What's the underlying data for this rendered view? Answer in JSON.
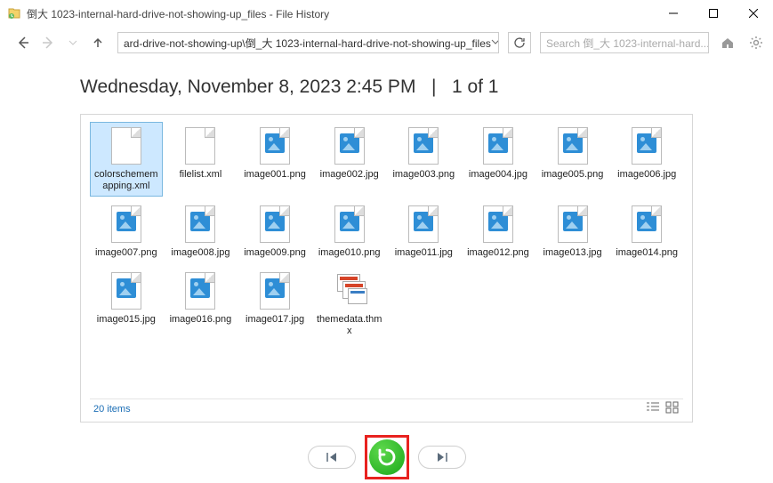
{
  "window": {
    "title": "倒大 1023-internal-hard-drive-not-showing-up_files - File History"
  },
  "toolbar": {
    "address": "ard-drive-not-showing-up\\倒_大 1023-internal-hard-drive-not-showing-up_files",
    "search_placeholder": "Search 倒_大 1023-internal-hard..."
  },
  "heading": {
    "datetime": "Wednesday, November 8, 2023 2:45 PM",
    "separator": "|",
    "position": "1 of 1"
  },
  "files": [
    {
      "name": "colorschememapping.xml",
      "type": "doc",
      "selected": true
    },
    {
      "name": "filelist.xml",
      "type": "doc",
      "selected": false
    },
    {
      "name": "image001.png",
      "type": "img",
      "selected": false
    },
    {
      "name": "image002.jpg",
      "type": "img",
      "selected": false
    },
    {
      "name": "image003.png",
      "type": "img",
      "selected": false
    },
    {
      "name": "image004.jpg",
      "type": "img",
      "selected": false
    },
    {
      "name": "image005.png",
      "type": "img",
      "selected": false
    },
    {
      "name": "image006.jpg",
      "type": "img",
      "selected": false
    },
    {
      "name": "image007.png",
      "type": "img",
      "selected": false
    },
    {
      "name": "image008.jpg",
      "type": "img",
      "selected": false
    },
    {
      "name": "image009.png",
      "type": "img",
      "selected": false
    },
    {
      "name": "image010.png",
      "type": "img",
      "selected": false
    },
    {
      "name": "image011.jpg",
      "type": "img",
      "selected": false
    },
    {
      "name": "image012.png",
      "type": "img",
      "selected": false
    },
    {
      "name": "image013.jpg",
      "type": "img",
      "selected": false
    },
    {
      "name": "image014.png",
      "type": "img",
      "selected": false
    },
    {
      "name": "image015.jpg",
      "type": "img",
      "selected": false
    },
    {
      "name": "image016.png",
      "type": "img",
      "selected": false
    },
    {
      "name": "image017.jpg",
      "type": "img",
      "selected": false
    },
    {
      "name": "themedata.thmx",
      "type": "thm",
      "selected": false
    }
  ],
  "footer": {
    "count": "20 items"
  }
}
